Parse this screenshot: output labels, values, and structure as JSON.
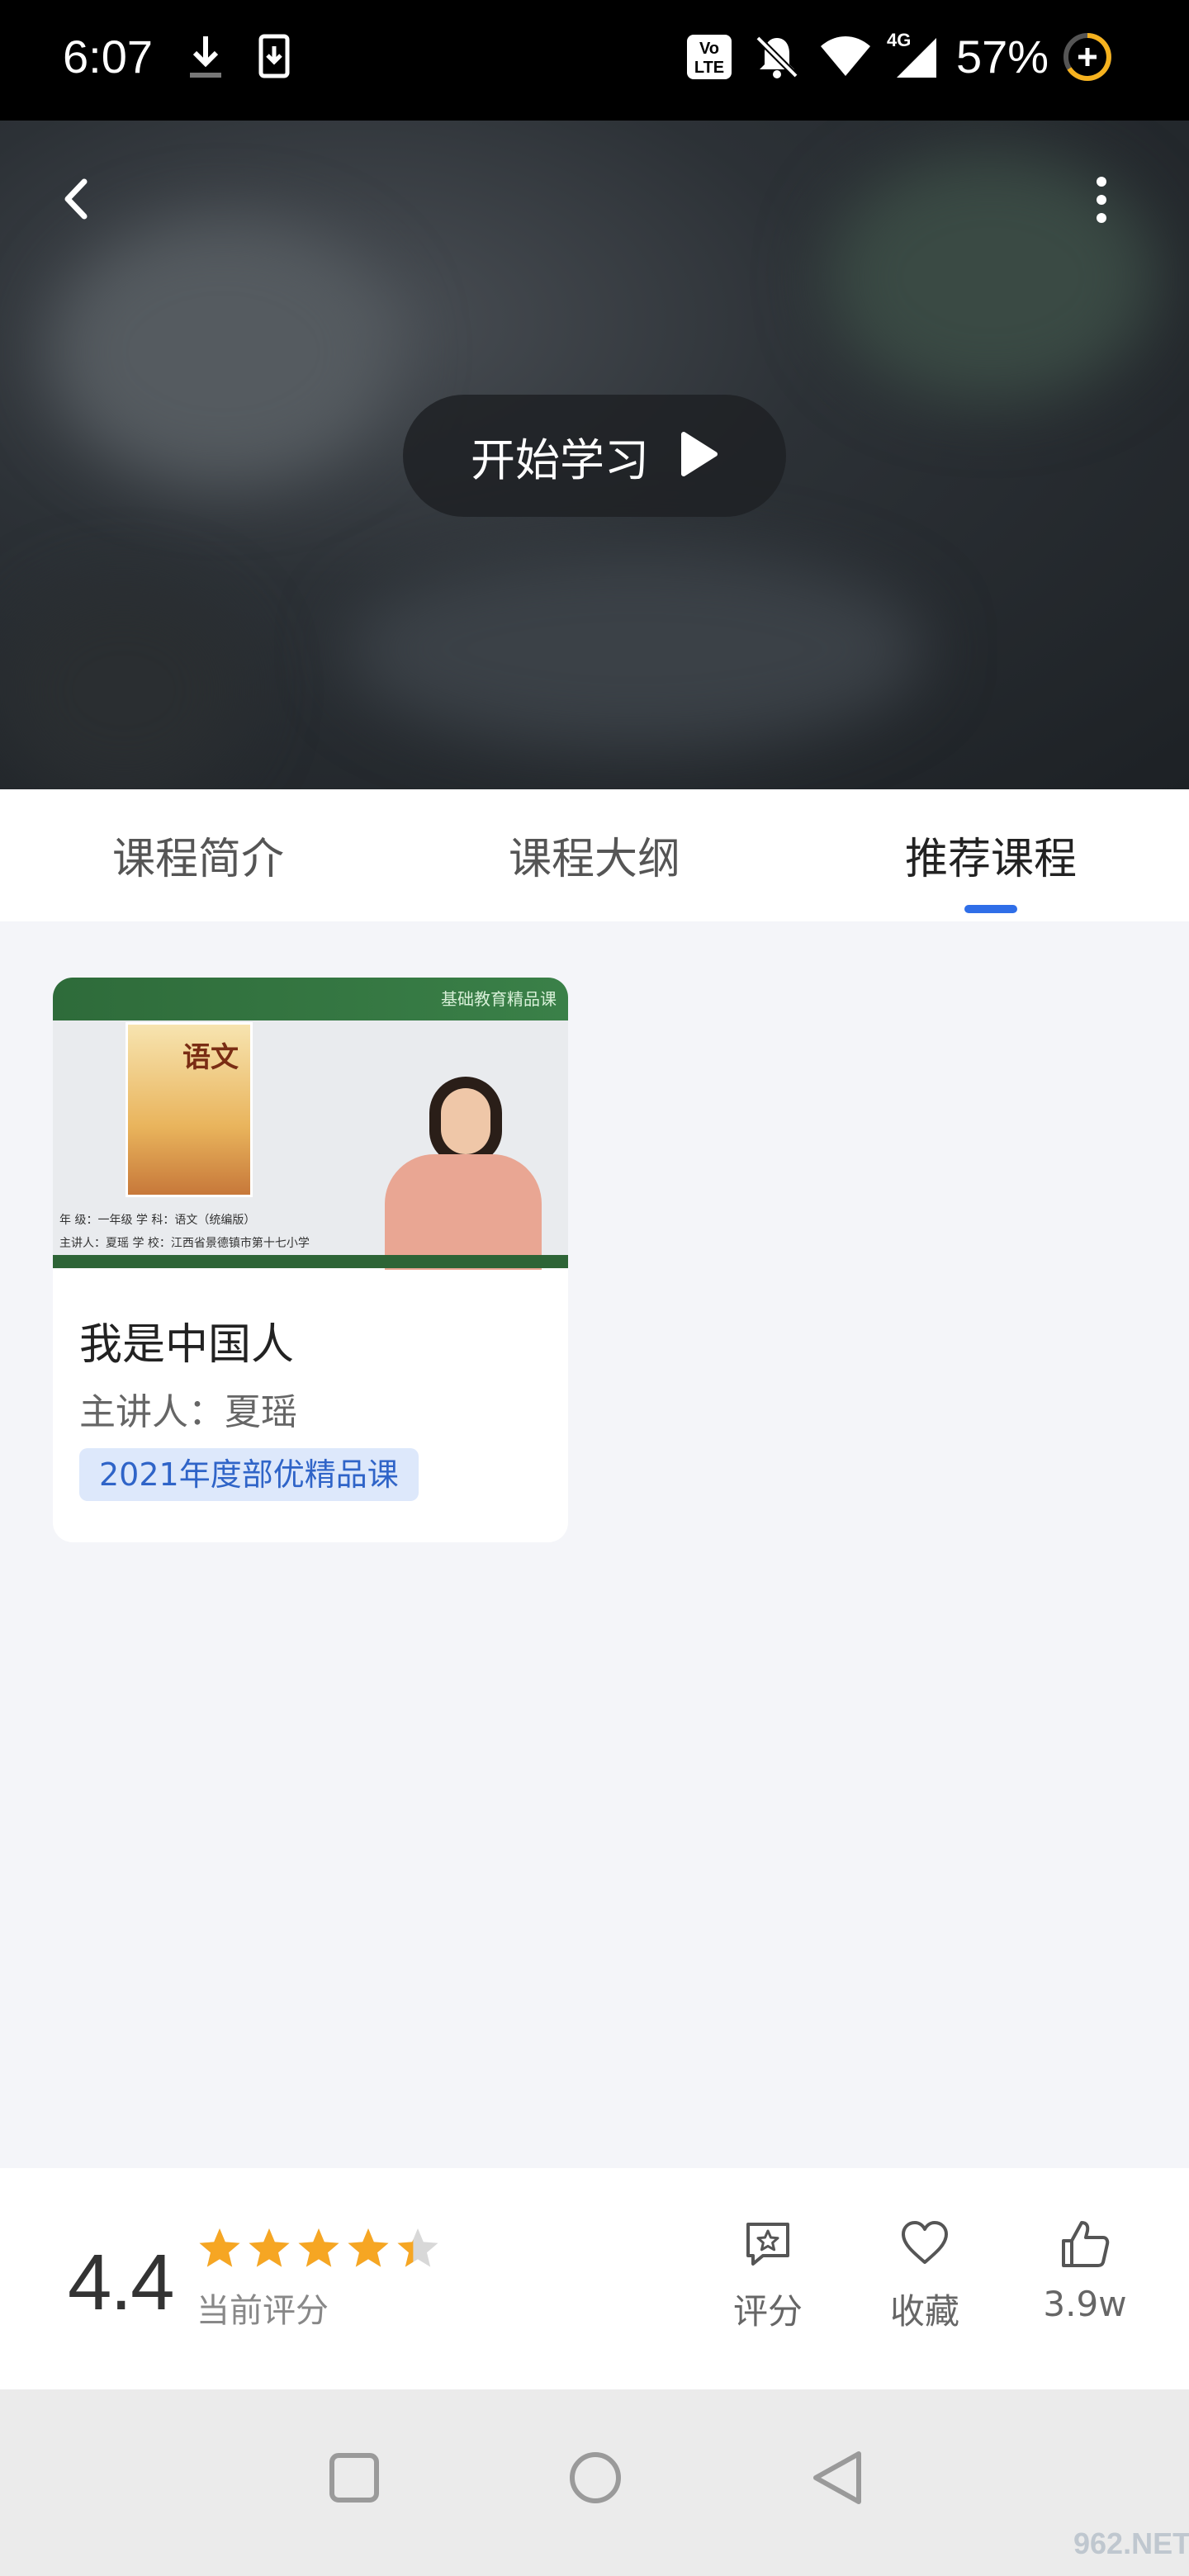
{
  "status_bar": {
    "time": "6:07",
    "battery": "57%",
    "icons": [
      "download-icon",
      "sim-icon",
      "volte-icon",
      "bell-off-icon",
      "wifi-icon",
      "signal-4g-icon",
      "battery-saver-icon"
    ],
    "volte_label": "Vo LTE",
    "network_label": "4G"
  },
  "hero": {
    "start_label": "开始学习"
  },
  "tabs": [
    {
      "label": "课程简介",
      "active": false
    },
    {
      "label": "课程大纲",
      "active": false
    },
    {
      "label": "推荐课程",
      "active": true
    }
  ],
  "colors": {
    "accent": "#2f6ee8",
    "star": "#f6a623",
    "tag_bg": "#dde8fb",
    "tag_text": "#2f64c8"
  },
  "course_card": {
    "thumbnail": {
      "brand": "基础教育精品课",
      "book_title": "语文",
      "info_line1": "年 级：一年级    学 科：语文（统编版）",
      "info_line2": "主讲人：夏瑶    学 校：江西省景德镇市第十七小学"
    },
    "title": "我是中国人",
    "teacher": "主讲人：夏瑶",
    "tag": "2021年度部优精品课"
  },
  "rating": {
    "score": "4.4",
    "stars": 4.4,
    "label": "当前评分"
  },
  "actions": [
    {
      "icon": "rate-icon",
      "label": "评分"
    },
    {
      "icon": "heart-icon",
      "label": "收藏"
    },
    {
      "icon": "thumbs-up-icon",
      "label": "3.9w"
    }
  ],
  "watermark": "962.NET"
}
